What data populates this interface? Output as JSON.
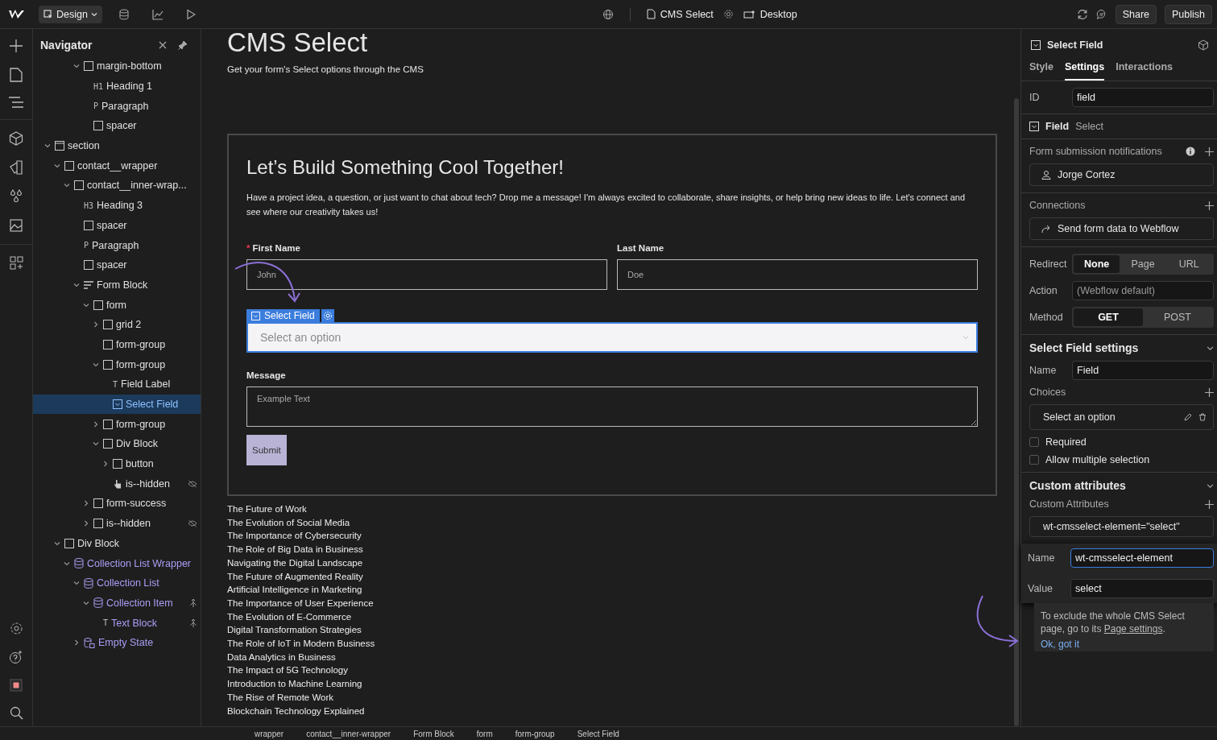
{
  "topbar": {
    "mode": "Design",
    "page": "CMS Select",
    "device": "Desktop",
    "share": "Share",
    "publish": "Publish"
  },
  "navigator": {
    "title": "Navigator",
    "items": [
      {
        "label": "margin-bottom",
        "kind": "box",
        "expanded": true,
        "selected": false,
        "children": [
          {
            "label": "Heading 1",
            "tag": "H1",
            "selected": false
          },
          {
            "label": "Paragraph",
            "tag": "P",
            "selected": false
          },
          {
            "label": "spacer",
            "kind": "box",
            "selected": false
          }
        ]
      },
      {
        "label": "section",
        "kind": "section",
        "expanded": true,
        "selected": false,
        "children": [
          {
            "label": "contact__wrapper",
            "kind": "box",
            "expanded": true,
            "selected": false,
            "children": [
              {
                "label": "contact__inner-wrap...",
                "kind": "box",
                "expanded": true,
                "selected": false,
                "children": [
                  {
                    "label": "Heading 3",
                    "tag": "H3",
                    "selected": false
                  },
                  {
                    "label": "spacer",
                    "kind": "box",
                    "selected": false
                  },
                  {
                    "label": "Paragraph",
                    "tag": "P",
                    "selected": false
                  },
                  {
                    "label": "spacer",
                    "kind": "box",
                    "selected": false
                  },
                  {
                    "label": "Form Block",
                    "kind": "form",
                    "expanded": true,
                    "selected": false,
                    "children": [
                      {
                        "label": "form",
                        "kind": "box",
                        "expanded": true,
                        "selected": false,
                        "children": [
                          {
                            "label": "grid 2",
                            "kind": "box",
                            "expanded": false,
                            "selected": false
                          },
                          {
                            "label": "form-group",
                            "kind": "box",
                            "selected": false
                          },
                          {
                            "label": "form-group",
                            "kind": "box",
                            "expanded": true,
                            "selected": false,
                            "children": [
                              {
                                "label": "Field Label",
                                "tag": "T",
                                "selected": false
                              },
                              {
                                "label": "Select Field",
                                "kind": "select",
                                "selected": true
                              }
                            ]
                          },
                          {
                            "label": "form-group",
                            "kind": "box",
                            "expanded": false,
                            "selected": false
                          },
                          {
                            "label": "Div Block",
                            "kind": "box",
                            "expanded": true,
                            "selected": false,
                            "children": [
                              {
                                "label": "button",
                                "kind": "box",
                                "expanded": false,
                                "selected": false
                              },
                              {
                                "label": "is--hidden",
                                "kind": "hand",
                                "hidden": true,
                                "selected": false
                              }
                            ]
                          }
                        ]
                      },
                      {
                        "label": "form-success",
                        "kind": "box",
                        "expanded": false,
                        "selected": false
                      },
                      {
                        "label": "is--hidden",
                        "kind": "box",
                        "expanded": false,
                        "hidden": true,
                        "selected": false
                      }
                    ]
                  }
                ]
              }
            ]
          },
          {
            "label": "Div Block",
            "kind": "box",
            "expanded": true,
            "selected": false,
            "children": [
              {
                "label": "Collection List Wrapper",
                "kind": "collection",
                "cms": true,
                "expanded": true,
                "selected": false,
                "children": [
                  {
                    "label": "Collection List",
                    "kind": "collection",
                    "cms": true,
                    "expanded": true,
                    "selected": false,
                    "children": [
                      {
                        "label": "Collection Item",
                        "kind": "collection",
                        "cms": true,
                        "expanded": true,
                        "linked": true,
                        "selected": false,
                        "children": [
                          {
                            "label": "Text Block",
                            "tag": "T",
                            "cms": true,
                            "linked": true,
                            "selected": false
                          }
                        ]
                      }
                    ]
                  },
                  {
                    "label": "Empty State",
                    "kind": "empty",
                    "cms": true,
                    "expanded": false,
                    "selected": false
                  }
                ]
              }
            ]
          }
        ]
      }
    ]
  },
  "canvas": {
    "page_title": "CMS Select",
    "page_subtitle": "Get your form's Select options through the CMS",
    "form": {
      "heading": "Let’s Build Something Cool Together!",
      "intro": "Have a project idea, a question, or just want to chat about tech? Drop me a message! I'm always excited to collaborate, share insights, or help bring new ideas to life. Let's connect and see where our creativity takes us!",
      "fields": [
        {
          "label": "First Name",
          "required_mark": "*",
          "placeholder": "John"
        },
        {
          "label": "Last Name",
          "placeholder": "Doe"
        }
      ],
      "select": {
        "badge": "Select Field",
        "placeholder": "Select an option"
      },
      "message": {
        "label": "Message",
        "placeholder": "Example Text"
      },
      "submit": "Submit"
    },
    "collection_items": [
      "The Future of Work",
      "The Evolution of Social Media",
      "The Importance of Cybersecurity",
      "The Role of Big Data in Business",
      "Navigating the Digital Landscape",
      "The Future of Augmented Reality",
      "Artificial Intelligence in Marketing",
      "The Importance of User Experience",
      "The Evolution of E-Commerce",
      "Digital Transformation Strategies",
      "The Role of IoT in Modern Business",
      "Data Analytics in Business",
      "The Impact of 5G Technology",
      "Introduction to Machine Learning",
      "The Rise of Remote Work",
      "Blockchain Technology Explained"
    ]
  },
  "breadcrumb": [
    "wrapper",
    "contact__inner-wrapper",
    "Form Block",
    "form",
    "form-group",
    "Select Field"
  ],
  "settings": {
    "element": "Select Field",
    "tabs": [
      {
        "label": "Style",
        "selected": false
      },
      {
        "label": "Settings",
        "selected": true
      },
      {
        "label": "Interactions",
        "selected": false
      }
    ],
    "id": {
      "label": "ID",
      "value": "field"
    },
    "field_type": {
      "label": "Field",
      "type": "Select"
    },
    "notifications": {
      "label": "Form submission notifications",
      "recipient": "Jorge Cortez"
    },
    "connections": {
      "label": "Connections",
      "item": "Send form data to Webflow"
    },
    "redirect": {
      "label": "Redirect",
      "options": [
        {
          "label": "None",
          "selected": true
        },
        {
          "label": "Page",
          "selected": false
        },
        {
          "label": "URL",
          "selected": false
        }
      ]
    },
    "action": {
      "label": "Action",
      "placeholder": "(Webflow default)"
    },
    "method": {
      "label": "Method",
      "options": [
        {
          "label": "GET",
          "selected": true
        },
        {
          "label": "POST",
          "selected": false
        }
      ]
    },
    "select_settings": {
      "title": "Select Field settings",
      "name_label": "Name",
      "name_value": "Field",
      "choices_label": "Choices",
      "choices": [
        "Select an option"
      ],
      "checkboxes": [
        {
          "label": "Required",
          "checked": false
        },
        {
          "label": "Allow multiple selection",
          "checked": false
        }
      ]
    },
    "custom_attributes": {
      "title": "Custom attributes",
      "label": "Custom Attributes",
      "items": [
        "wt-cmsselect-element=\"select\""
      ],
      "editor": {
        "name_label": "Name",
        "name_value": "wt-cmsselect-element",
        "value_label": "Value",
        "value_value": "select"
      }
    },
    "tip": {
      "text": "To exclude the whole CMS Select page, go to its",
      "link": "Page settings",
      "end": ".",
      "action": "Ok, got it"
    }
  }
}
